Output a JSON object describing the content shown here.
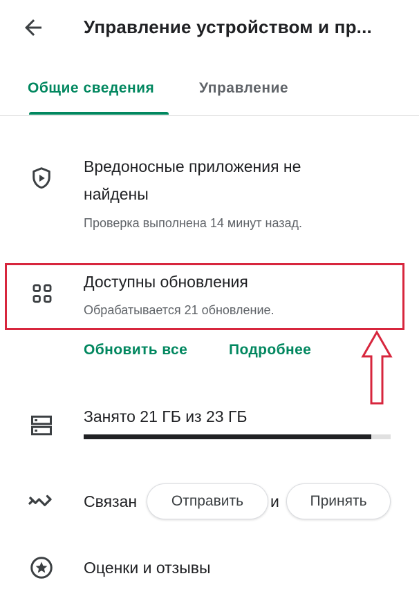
{
  "header": {
    "title": "Управление устройством и пр...",
    "back_icon": "arrow-back-icon"
  },
  "tabs": [
    {
      "label": "Общие сведения",
      "selected": true
    },
    {
      "label": "Управление",
      "selected": false
    }
  ],
  "security": {
    "icon": "shield-play-icon",
    "title": "Вредоносные приложения не найдены",
    "title_line1": "Вредоносные приложения не",
    "title_line2": "найдены",
    "subtitle": "Проверка выполнена 14 минут назад."
  },
  "updates": {
    "icon": "apps-grid-icon",
    "title": "Доступны обновления",
    "subtitle": "Обрабатывается 21 обновление.",
    "update_all_label": "Обновить все",
    "details_label": "Подробнее"
  },
  "storage": {
    "icon": "storage-icon",
    "label": "Занято 21 ГБ из 23 ГБ",
    "used_fraction": 0.938
  },
  "related": {
    "icon": "wave-sync-icon",
    "label_visible": "Связан",
    "label_tail": "и"
  },
  "chips": {
    "send_label": "Отправить",
    "accept_label": "Принять"
  },
  "ratings": {
    "icon": "star-circle-icon",
    "label": "Оценки и отзывы"
  },
  "colors": {
    "accent": "#01875f",
    "highlight": "#d7263d",
    "text_primary": "#202124",
    "text_secondary": "#5f6368"
  }
}
